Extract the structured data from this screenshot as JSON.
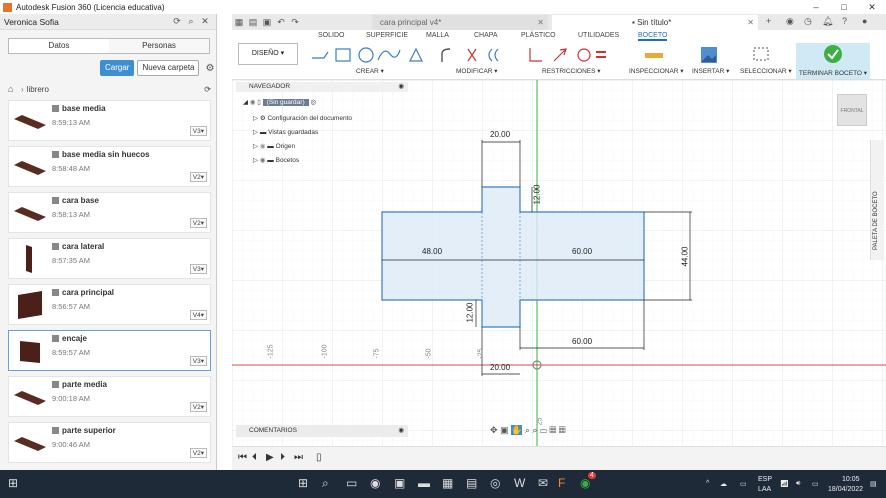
{
  "window": {
    "title": "Autodesk Fusion 360 (Licencia educativa)"
  },
  "data_panel": {
    "user": "Veronica Sofia",
    "tabs": [
      "Datos",
      "Personas"
    ],
    "upload_label": "Cargar",
    "new_folder_label": "Nueva carpeta",
    "breadcrumb": "librero",
    "files": [
      {
        "name": "base media",
        "time": "8:59:13 AM",
        "version": "V3"
      },
      {
        "name": "base media sin huecos",
        "time": "8:58:48 AM",
        "version": "V2"
      },
      {
        "name": "cara base",
        "time": "8:58:13 AM",
        "version": "V2"
      },
      {
        "name": "cara lateral",
        "time": "8:57:35 AM",
        "version": "V3"
      },
      {
        "name": "cara principal",
        "time": "8:56:57 AM",
        "version": "V4"
      },
      {
        "name": "encaje",
        "time": "8:59:57 AM",
        "version": "V3"
      },
      {
        "name": "parte media",
        "time": "9:00:18 AM",
        "version": "V2"
      },
      {
        "name": "parte superior",
        "time": "9:00:46 AM",
        "version": "V2"
      }
    ]
  },
  "doc_tabs": [
    {
      "label": "cara principal v4*"
    },
    {
      "label": "Sin título*"
    }
  ],
  "ribbon": {
    "tabs": [
      "SOLIDO",
      "SUPERFICIE",
      "MALLA",
      "CHAPA",
      "PLÁSTICO",
      "UTILIDADES",
      "BOCETO"
    ],
    "active_tab": "BOCETO",
    "workspace": "DISEÑO",
    "groups": [
      "CREAR",
      "MODIFICAR",
      "RESTRICCIONES",
      "INSPECCIONAR",
      "INSERTAR",
      "SELECCIONAR",
      "TERMINAR BOCETO"
    ]
  },
  "navigator": {
    "header": "NAVEGADOR",
    "root": "(Sin guardar)",
    "items": [
      "Configuración del documento",
      "Vistas guardadas",
      "Origen",
      "Bocetos"
    ]
  },
  "comments_label": "COMENTARIOS",
  "side_palette": "PALETA DE BOCETO",
  "viewcube_label": "FRONTAL",
  "sketch": {
    "dimensions": [
      "20.00",
      "12.00",
      "48.00",
      "60.00",
      "44.00",
      "12.00",
      "60.00",
      "20.00"
    ],
    "axis_ticks": [
      "-125",
      "-100",
      "-75",
      "-50",
      "-25"
    ],
    "axis_tick_end": "25"
  },
  "taskbar": {
    "lang": "ESP",
    "lang2": "LAA",
    "time": "10:05",
    "date": "18/04/2022",
    "badge": "4"
  },
  "colors": {
    "accent": "#1d6fb8",
    "sketch_line": "#3a7fc0",
    "sketch_fill": "#dceaf7",
    "axis_green": "#3cb043",
    "axis_red": "#d94848"
  }
}
